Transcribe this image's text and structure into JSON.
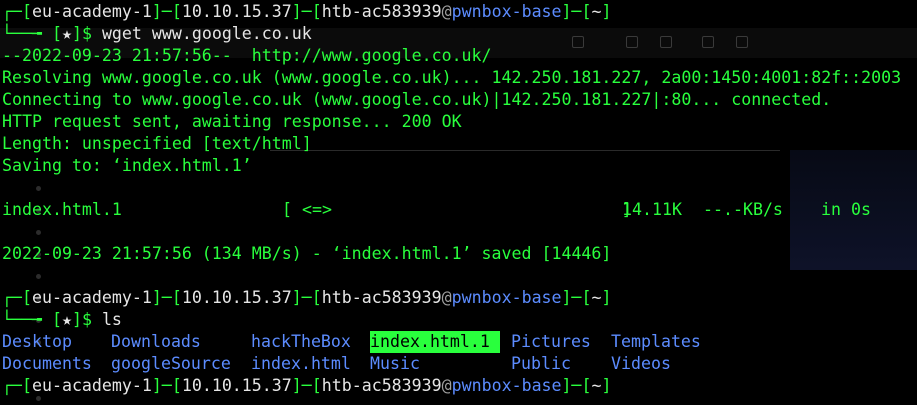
{
  "prompt": {
    "academy": "eu-academy-1",
    "ip": "10.10.15.37",
    "user": "htb-ac583939",
    "host": "pwnbox-base",
    "path": "~",
    "star": "★"
  },
  "commands": {
    "wget": "wget www.google.co.uk",
    "ls": "ls"
  },
  "wget_output": {
    "start": "--2022-09-23 21:57:56--  http://www.google.co.uk/",
    "resolving": "Resolving www.google.co.uk (www.google.co.uk)... 142.250.181.227, 2a00:1450:4001:82f::2003",
    "connecting": "Connecting to www.google.co.uk (www.google.co.uk)|142.250.181.227|:80... connected.",
    "request": "HTTP request sent, awaiting response... 200 OK",
    "length": "Length: unspecified [text/html]",
    "saving": "Saving to: ‘index.html.1’",
    "progress_file": "index.html.1",
    "progress_bar": "[ <=>                             ]",
    "progress_size": "14.11K",
    "progress_rate": "--.-KB/s",
    "progress_eta": "in 0s",
    "saved": "2022-09-23 21:57:56 (134 MB/s) - ‘index.html.1’ saved [14446]"
  },
  "ls_output": {
    "row1": [
      {
        "name": "Desktop",
        "kind": "dir"
      },
      {
        "name": "Downloads",
        "kind": "dir"
      },
      {
        "name": "hackTheBox",
        "kind": "dir"
      },
      {
        "name": "index.html.1",
        "kind": "highlight"
      },
      {
        "name": "Pictures",
        "kind": "dir"
      },
      {
        "name": "Templates",
        "kind": "dir"
      }
    ],
    "row2": [
      {
        "name": "Documents",
        "kind": "dir"
      },
      {
        "name": "googleSource",
        "kind": "dir"
      },
      {
        "name": "index.html",
        "kind": "dir"
      },
      {
        "name": "Music",
        "kind": "dir"
      },
      {
        "name": "Public",
        "kind": "dir"
      },
      {
        "name": "Videos",
        "kind": "dir"
      }
    ]
  },
  "colors": {
    "background": "#000000",
    "green": "#29ff3d",
    "white": "#e6e6e6",
    "blue": "#5c8cff"
  }
}
